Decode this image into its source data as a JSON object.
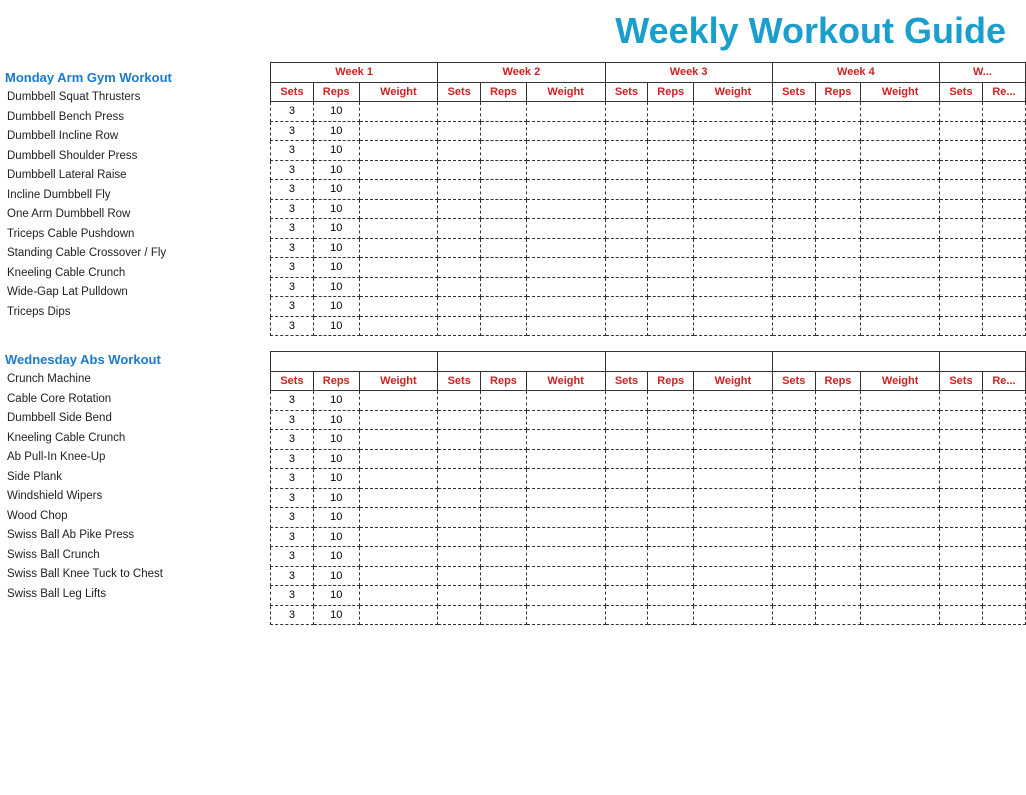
{
  "title": "Weekly Workout Guide",
  "sections": [
    {
      "id": "monday",
      "header": "Monday Arm Gym Workout",
      "exercises": [
        "Dumbbell Squat Thrusters",
        "Dumbbell Bench Press",
        "Dumbbell Incline Row",
        "Dumbbell Shoulder Press",
        "Dumbbell Lateral Raise",
        "Incline Dumbbell Fly",
        "One Arm Dumbbell Row",
        "Triceps Cable Pushdown",
        "Standing Cable Crossover / Fly",
        "Kneeling Cable Crunch",
        "Wide-Gap Lat Pulldown",
        "Triceps Dips"
      ]
    },
    {
      "id": "wednesday",
      "header": "Wednesday Abs Workout",
      "exercises": [
        "Crunch Machine",
        "Cable Core Rotation",
        "Dumbbell Side Bend",
        "Kneeling Cable Crunch",
        "Ab Pull-In Knee-Up",
        "Side Plank",
        "Windshield Wipers",
        "Wood Chop",
        "Swiss Ball Ab Pike Press",
        "Swiss Ball Crunch",
        "Swiss Ball Knee Tuck to Chest",
        "Swiss Ball Leg Lifts"
      ]
    }
  ],
  "weeks": [
    "Week 1",
    "Week 2",
    "Week 3",
    "Week 4",
    "W..."
  ],
  "col_headers": [
    "Sets",
    "Reps",
    "Weight"
  ],
  "default_sets": "3",
  "default_reps": "10"
}
